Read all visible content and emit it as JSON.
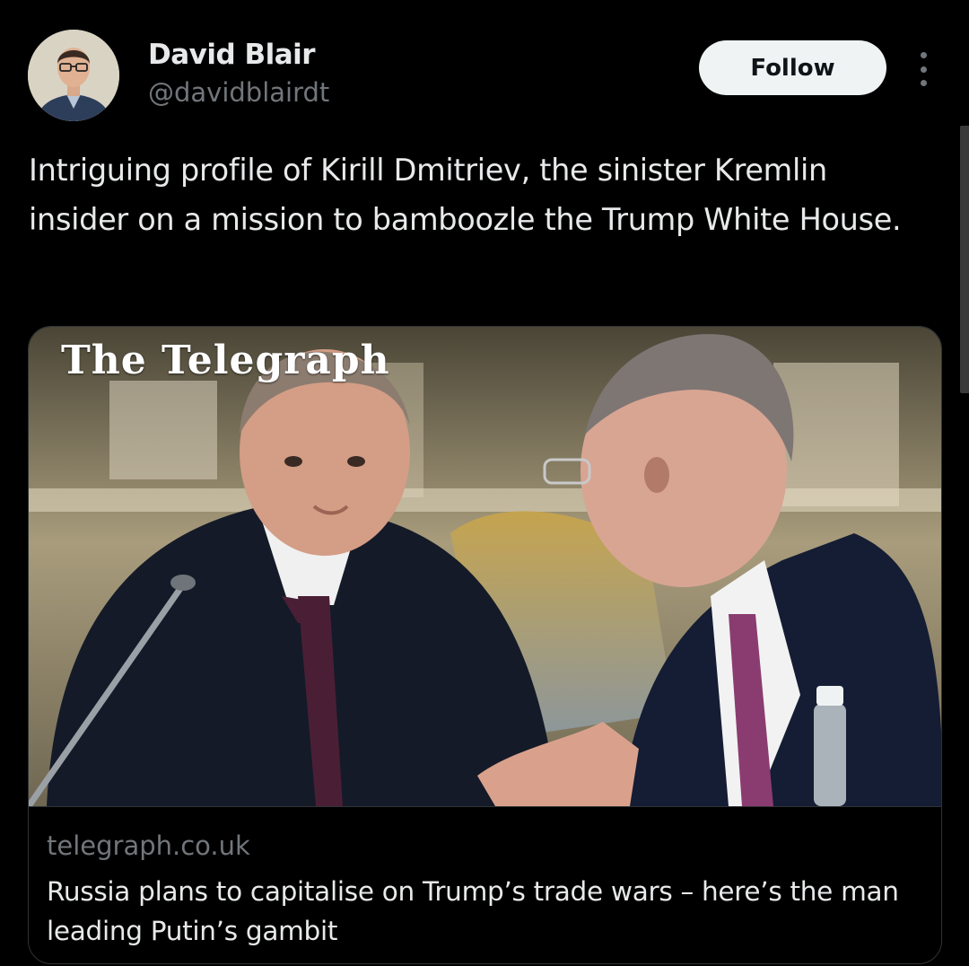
{
  "author": {
    "display_name": "David Blair",
    "handle": "@davidblairdt",
    "avatar_icon": "profile-photo"
  },
  "actions": {
    "follow_label": "Follow",
    "more_icon": "ellipsis-vertical-icon"
  },
  "tweet": {
    "text": "Intriguing profile of Kirill Dmitriev, the sinister Kremlin insider on a mission to bamboozle the Trump White House."
  },
  "link_card": {
    "masthead": "The Telegraph",
    "domain": "telegraph.co.uk",
    "title": "Russia plans to capitalise on Trump’s trade wars – here’s the man leading Putin’s gambit"
  },
  "colors": {
    "background": "#000000",
    "primary_text": "#e7e9ea",
    "secondary_text": "#71767b",
    "border": "#2f3336",
    "follow_button_bg": "#eff3f4"
  }
}
